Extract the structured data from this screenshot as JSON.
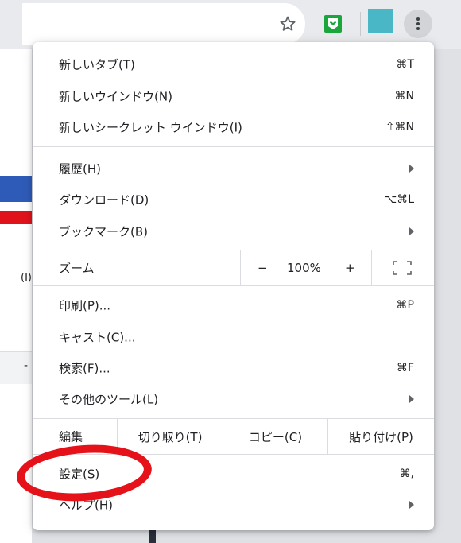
{
  "colors": {
    "avatar": "#4ab7c6",
    "extension": "#1aa63a",
    "annotation": "#e5121a"
  },
  "toolbar": {
    "icons": [
      "star-icon",
      "extension-icon",
      "kebab-menu-icon"
    ]
  },
  "background_fragments": {
    "frag1": "(I)",
    "frag2": "-"
  },
  "menu": {
    "new_tab": {
      "label": "新しいタブ(T)",
      "shortcut": "⌘T"
    },
    "new_window": {
      "label": "新しいウインドウ(N)",
      "shortcut": "⌘N"
    },
    "new_incognito": {
      "label": "新しいシークレット ウインドウ(I)",
      "shortcut": "⇧⌘N"
    },
    "history": {
      "label": "履歴(H)"
    },
    "downloads": {
      "label": "ダウンロード(D)",
      "shortcut": "⌥⌘L"
    },
    "bookmarks": {
      "label": "ブックマーク(B)"
    },
    "zoom": {
      "label": "ズーム",
      "minus": "−",
      "value": "100%",
      "plus": "+"
    },
    "print": {
      "label": "印刷(P)...",
      "shortcut": "⌘P"
    },
    "cast": {
      "label": "キャスト(C)..."
    },
    "find": {
      "label": "検索(F)...",
      "shortcut": "⌘F"
    },
    "more_tools": {
      "label": "その他のツール(L)"
    },
    "edit": {
      "label": "編集",
      "cut": "切り取り(T)",
      "copy": "コピー(C)",
      "paste": "貼り付け(P)"
    },
    "settings": {
      "label": "設定(S)",
      "shortcut": "⌘,"
    },
    "help": {
      "label": "ヘルプ(H)"
    }
  }
}
